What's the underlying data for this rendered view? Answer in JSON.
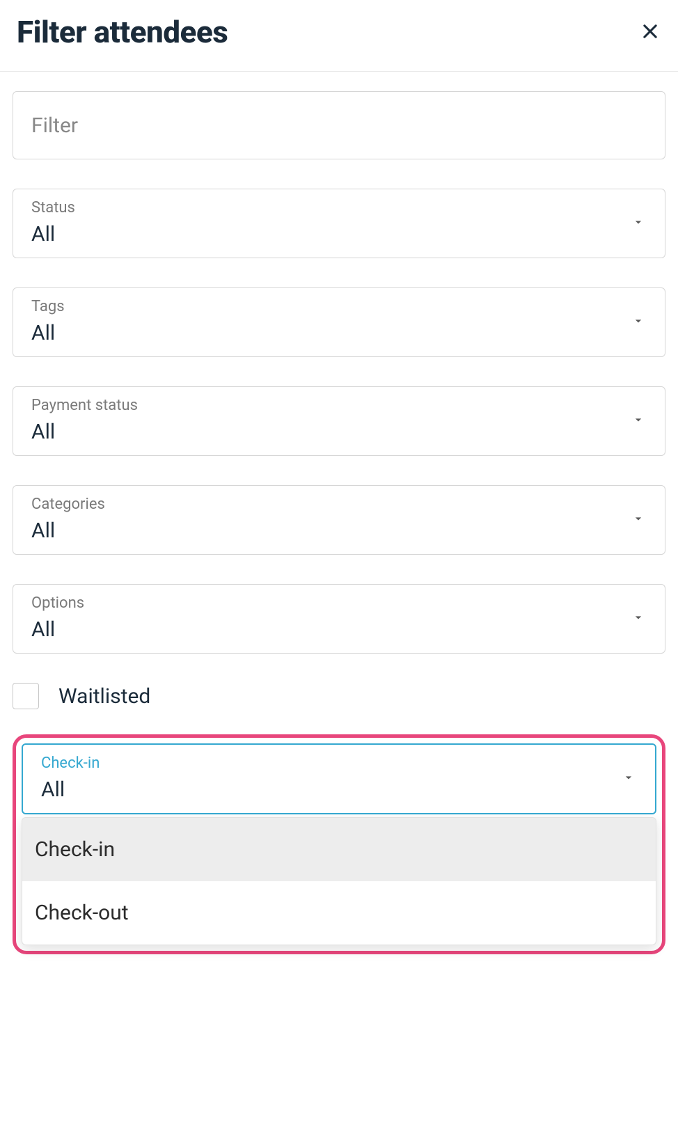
{
  "header": {
    "title": "Filter attendees"
  },
  "filter_input": {
    "placeholder": "Filter",
    "value": ""
  },
  "selects": {
    "status": {
      "label": "Status",
      "value": "All"
    },
    "tags": {
      "label": "Tags",
      "value": "All"
    },
    "payment_status": {
      "label": "Payment status",
      "value": "All"
    },
    "categories": {
      "label": "Categories",
      "value": "All"
    },
    "options": {
      "label": "Options",
      "value": "All"
    },
    "checkin": {
      "label": "Check-in",
      "value": "All"
    }
  },
  "waitlisted": {
    "label": "Waitlisted",
    "checked": false
  },
  "checkin_dropdown": {
    "options": [
      "Check-in",
      "Check-out"
    ],
    "highlighted_index": 0
  }
}
